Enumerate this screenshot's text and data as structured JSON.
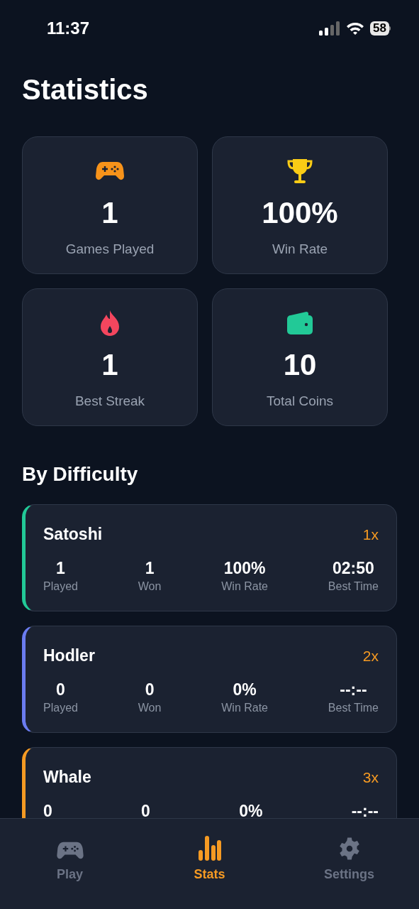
{
  "status_bar": {
    "time": "11:37",
    "battery": "58"
  },
  "title": "Statistics",
  "summary": [
    {
      "kind": "games",
      "value": "1",
      "label": "Games Played"
    },
    {
      "kind": "trophy",
      "value": "100%",
      "label": "Win Rate"
    },
    {
      "kind": "streak",
      "value": "1",
      "label": "Best Streak"
    },
    {
      "kind": "coins",
      "value": "10",
      "label": "Total Coins"
    }
  ],
  "section_title": "By Difficulty",
  "difficulties": [
    {
      "name": "Satoshi",
      "multiplier": "1x",
      "color": "#22c997",
      "stats": [
        {
          "value": "1",
          "label": "Played"
        },
        {
          "value": "1",
          "label": "Won"
        },
        {
          "value": "100%",
          "label": "Win Rate"
        },
        {
          "value": "02:50",
          "label": "Best Time"
        }
      ]
    },
    {
      "name": "Hodler",
      "multiplier": "2x",
      "color": "#6b7cf0",
      "stats": [
        {
          "value": "0",
          "label": "Played"
        },
        {
          "value": "0",
          "label": "Won"
        },
        {
          "value": "0%",
          "label": "Win Rate"
        },
        {
          "value": "--:--",
          "label": "Best Time"
        }
      ]
    },
    {
      "name": "Whale",
      "multiplier": "3x",
      "color": "#f59a23",
      "stats": [
        {
          "value": "0"
        },
        {
          "value": "0"
        },
        {
          "value": "0%"
        },
        {
          "value": "--:--"
        }
      ]
    }
  ],
  "tabs": [
    {
      "kind": "play",
      "label": "Play",
      "selected": false
    },
    {
      "kind": "stats",
      "label": "Stats",
      "selected": true
    },
    {
      "kind": "settings",
      "label": "Settings",
      "selected": false
    }
  ]
}
